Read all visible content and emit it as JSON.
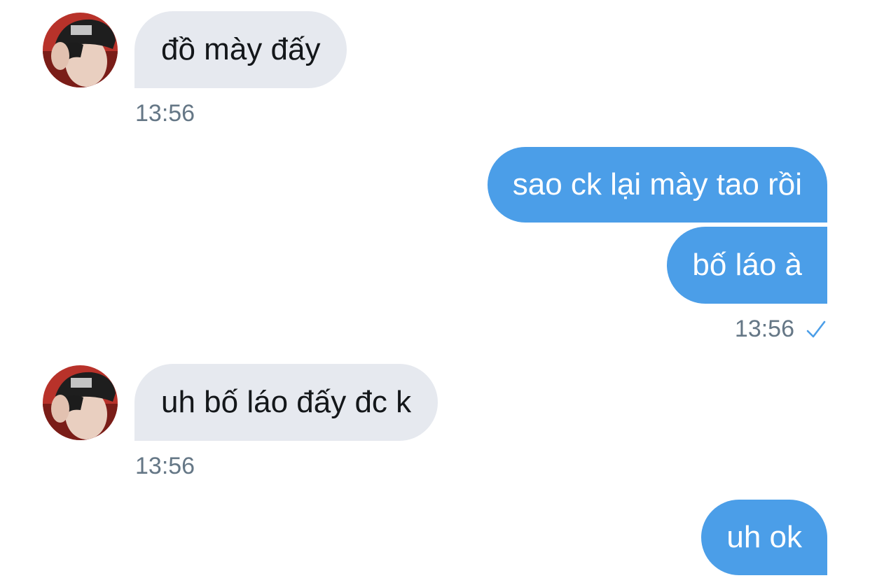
{
  "messages": [
    {
      "direction": "incoming",
      "text": "đồ mày đấy",
      "time": "13:56"
    },
    {
      "direction": "outgoing",
      "text": "sao ck lại mày tao rồi"
    },
    {
      "direction": "outgoing",
      "text": "bố láo à",
      "time": "13:56",
      "status_icon": "checkmark-icon"
    },
    {
      "direction": "incoming",
      "text": "uh bố láo đấy đc k",
      "time": "13:56"
    },
    {
      "direction": "outgoing",
      "text": "uh ok"
    }
  ],
  "colors": {
    "incoming_bubble": "#e6e9ef",
    "outgoing_bubble": "#4b9ee8",
    "timestamp": "#657786",
    "check": "#4b9ee8"
  }
}
